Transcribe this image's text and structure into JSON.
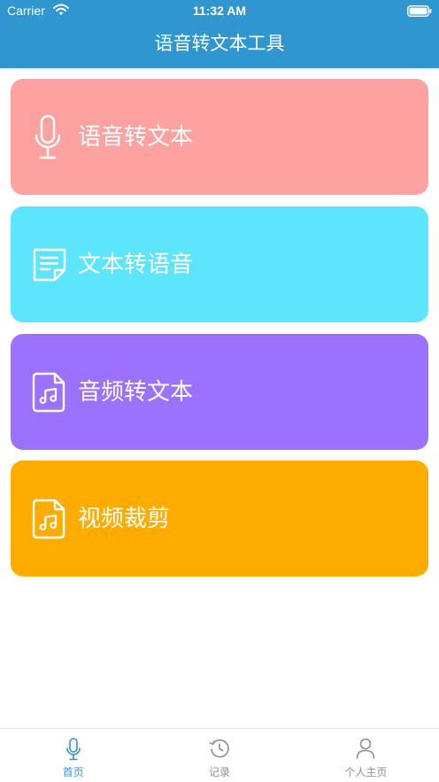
{
  "status_bar": {
    "carrier": "Carrier",
    "time": "11:32 AM",
    "icons": [
      "wifi-icon",
      "battery-icon"
    ]
  },
  "header": {
    "title": "语音转文本工具"
  },
  "cards": [
    {
      "label": "语音转文本",
      "icon": "microphone-icon",
      "color": "#fea1a1"
    },
    {
      "label": "文本转语音",
      "icon": "document-icon",
      "color": "#5de5fd"
    },
    {
      "label": "音频转文本",
      "icon": "music-file-icon",
      "color": "#9c71fe"
    },
    {
      "label": "视频裁剪",
      "icon": "music-file-icon",
      "color": "#feac00"
    }
  ],
  "tab_bar": {
    "items": [
      {
        "label": "首页",
        "icon": "microphone-icon",
        "active": true
      },
      {
        "label": "记录",
        "icon": "clock-icon",
        "active": false
      },
      {
        "label": "个人主页",
        "icon": "person-icon",
        "active": false
      }
    ]
  },
  "colors": {
    "header_bg": "#2f96cf",
    "tab_active": "#2f96cf",
    "tab_inactive": "#8e8e93"
  }
}
